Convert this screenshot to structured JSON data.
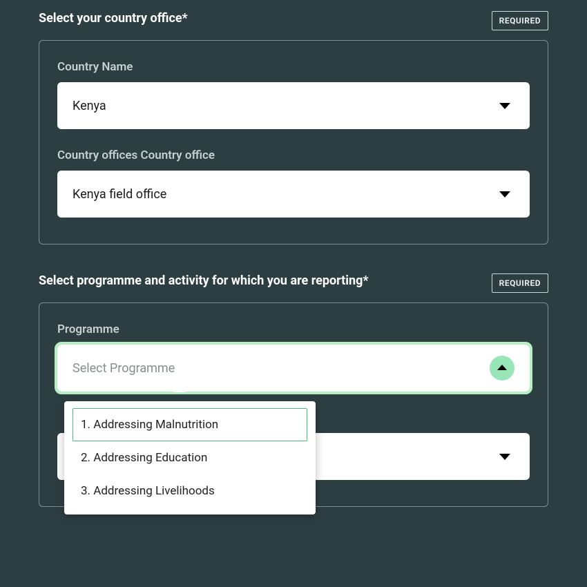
{
  "section1": {
    "title": "Select your country office*",
    "required_label": "REQUIRED",
    "country_name_label": "Country Name",
    "country_name_value": "Kenya",
    "country_office_label": "Country offices Country office",
    "country_office_value": "Kenya field office"
  },
  "section2": {
    "title": "Select programme and activity for which you are reporting*",
    "required_label": "REQUIRED",
    "programme_label": "Programme",
    "programme_placeholder": "Select Programme",
    "programme_options": {
      "0": "1. Addressing Malnutrition",
      "1": "2. Addressing Education",
      "2": "3. Addressing Livelihoods"
    }
  }
}
